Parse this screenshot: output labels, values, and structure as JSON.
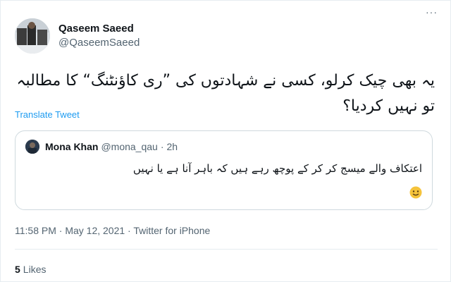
{
  "author": {
    "display_name": "Qaseem Saeed",
    "handle": "@QaseemSaeed"
  },
  "more_options": "···",
  "tweet_text": "یہ بھی چیک کرلو، کسی نے شہادتوں کی ”ری کاؤنٹنگ“ کا مطالبہ تو نہیں کردیا؟",
  "translate_label": "Translate Tweet",
  "quoted": {
    "display_name": "Mona Khan",
    "handle": "@mona_qau",
    "separator": "·",
    "time": "2h",
    "text": "اعتکاف والے میسج کر کر کے پوچھ رہے ہیں کہ باہر آنا ہے یا نہیں",
    "emoji": "smiling-face-emoji"
  },
  "meta": "11:58 PM · May 12, 2021 · Twitter for iPhone",
  "likes": {
    "count": "5",
    "label": "Likes"
  },
  "colors": {
    "accent": "#1d9bf0",
    "secondary_text": "#536471",
    "border": "#cfd9de"
  }
}
